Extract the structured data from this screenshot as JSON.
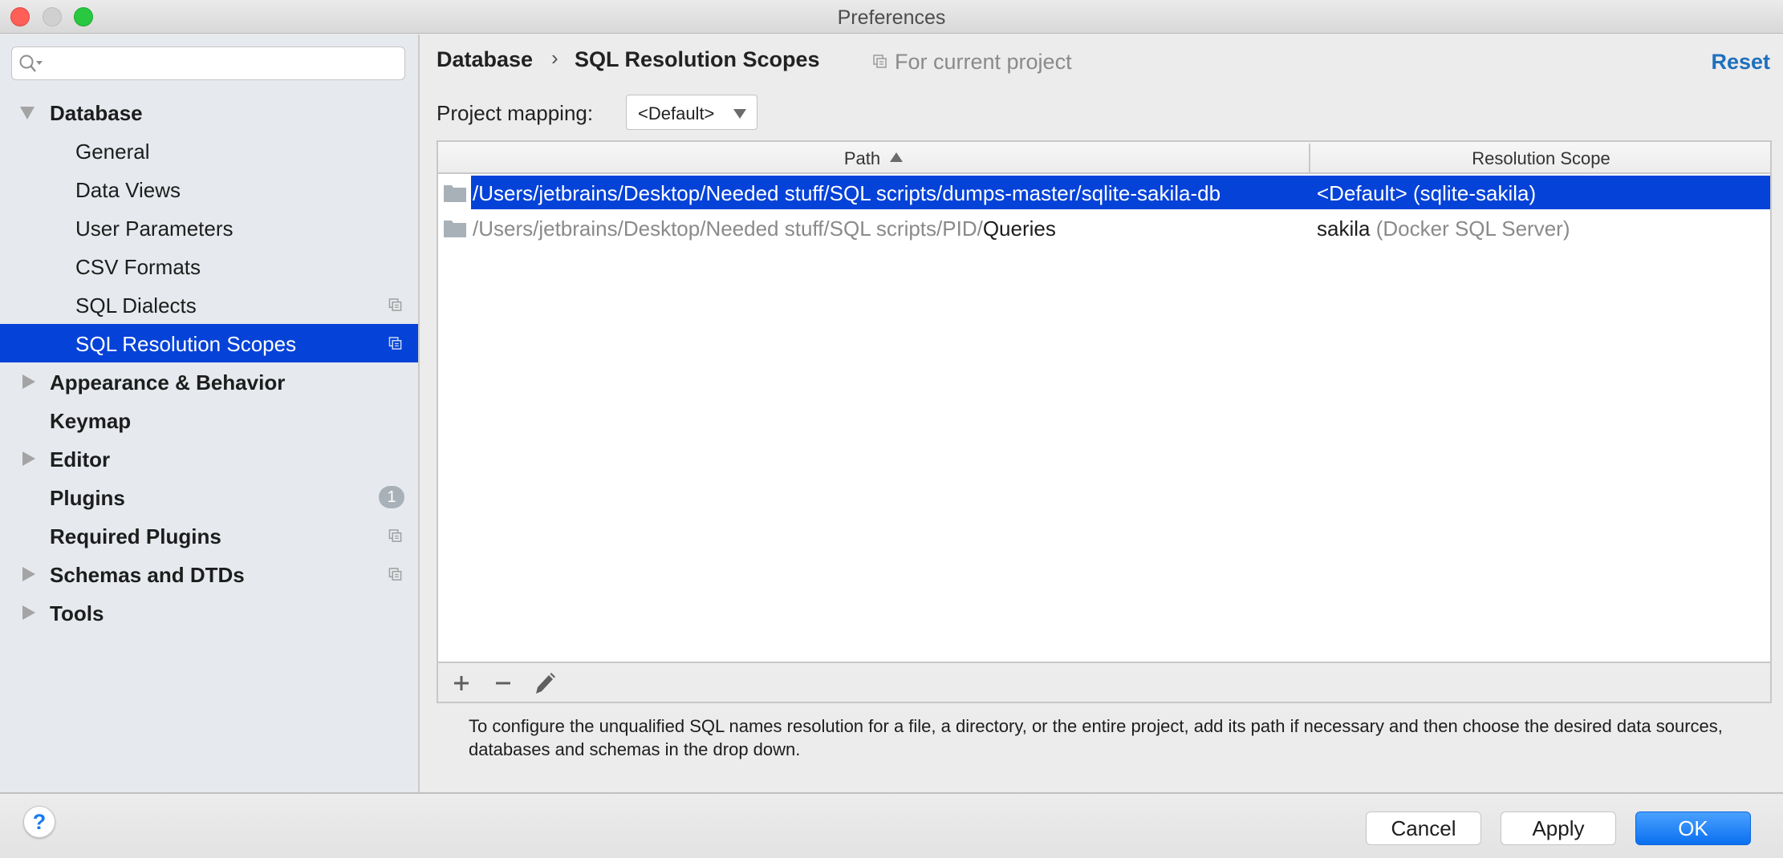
{
  "window": {
    "title": "Preferences"
  },
  "sidebar": {
    "search": {
      "placeholder": "",
      "value": ""
    },
    "items": [
      {
        "label": "Database",
        "level": "top",
        "expander": "expanded",
        "trailing": ""
      },
      {
        "label": "General",
        "level": "child",
        "expander": "",
        "trailing": ""
      },
      {
        "label": "Data Views",
        "level": "child",
        "expander": "",
        "trailing": ""
      },
      {
        "label": "User Parameters",
        "level": "child",
        "expander": "",
        "trailing": ""
      },
      {
        "label": "CSV Formats",
        "level": "child",
        "expander": "",
        "trailing": ""
      },
      {
        "label": "SQL Dialects",
        "level": "child",
        "expander": "",
        "trailing": "project-icon"
      },
      {
        "label": "SQL Resolution Scopes",
        "level": "child",
        "expander": "",
        "trailing": "project-icon",
        "selected": true
      },
      {
        "label": "Appearance & Behavior",
        "level": "top",
        "expander": "collapsed",
        "trailing": ""
      },
      {
        "label": "Keymap",
        "level": "top",
        "expander": "",
        "trailing": ""
      },
      {
        "label": "Editor",
        "level": "top",
        "expander": "collapsed",
        "trailing": ""
      },
      {
        "label": "Plugins",
        "level": "top",
        "expander": "",
        "trailing": "badge",
        "badge": "1"
      },
      {
        "label": "Required Plugins",
        "level": "top",
        "expander": "",
        "trailing": "project-icon"
      },
      {
        "label": "Schemas and DTDs",
        "level": "top",
        "expander": "collapsed",
        "trailing": "project-icon"
      },
      {
        "label": "Tools",
        "level": "top",
        "expander": "collapsed",
        "trailing": ""
      }
    ]
  },
  "header": {
    "breadcrumb": [
      "Database",
      "SQL Resolution Scopes"
    ],
    "breadcrumb_separator": "›",
    "scope_note": "For current project",
    "reset_label": "Reset"
  },
  "project_mapping": {
    "label": "Project mapping:",
    "value": "<Default>"
  },
  "table": {
    "columns": [
      {
        "label": "Path",
        "sort": "ascending"
      },
      {
        "label": "Resolution Scope"
      }
    ],
    "rows": [
      {
        "path_prefix": "/Users/jetbrains/Desktop/Needed stuff/SQL scripts/dumps-master/sqlite-sakila-db",
        "path_name": "",
        "scope_main": "<Default>",
        "scope_detail": "(sqlite-sakila)",
        "selected": true
      },
      {
        "path_prefix": "/Users/jetbrains/Desktop/Needed stuff/SQL scripts/PID/",
        "path_name": "Queries",
        "scope_main": "sakila",
        "scope_detail": "(Docker SQL Server)",
        "selected": false
      }
    ]
  },
  "toolbar": {
    "add": "add",
    "remove": "remove",
    "edit": "edit"
  },
  "description": "To configure the unqualified SQL names resolution for a file, a directory, or the entire project, add its path if necessary and then choose the desired data sources, databases and schemas in the drop down.",
  "footer": {
    "help_label": "?",
    "cancel_label": "Cancel",
    "apply_label": "Apply",
    "ok_label": "OK"
  },
  "colors": {
    "selection": "#0542d8",
    "link": "#1f6fbd",
    "primary_button": "#0a6ff0"
  }
}
